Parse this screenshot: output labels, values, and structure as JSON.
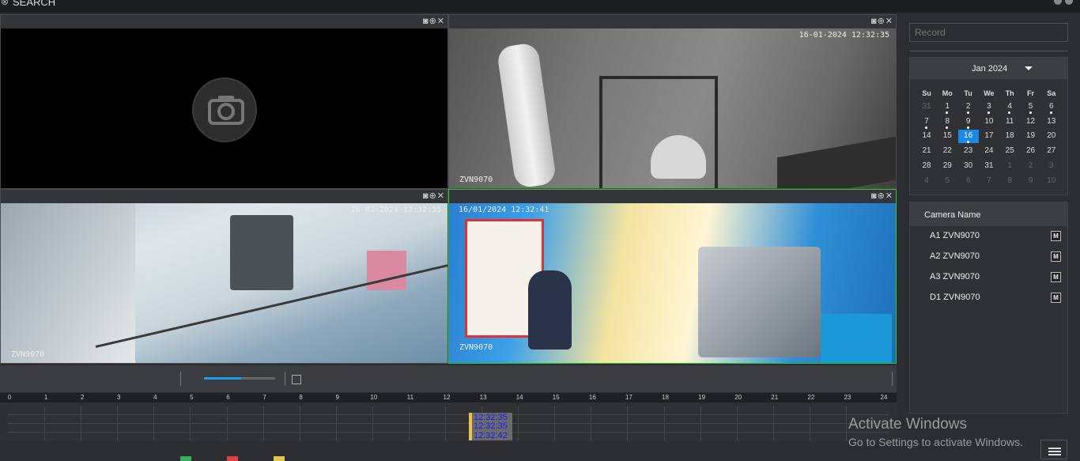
{
  "app": {
    "title": "SEARCH"
  },
  "tiles": [
    {
      "name": "tile-1",
      "timestamp": "",
      "camera_label": "",
      "empty": true
    },
    {
      "name": "tile-2",
      "timestamp": "16-01-2024 12:32:35",
      "camera_label": "ZVN9070"
    },
    {
      "name": "tile-3",
      "timestamp": "16-01-2024 12:32:35",
      "camera_label": "ZVN9070"
    },
    {
      "name": "tile-4",
      "timestamp": "16/01/2024 12:32:41",
      "camera_label": "ZVN9070",
      "active": true
    }
  ],
  "tile_tools": {
    "snapshot": "◙",
    "zoom": "⊕",
    "close": "✕"
  },
  "playback": {
    "speed_fraction": 0.52
  },
  "timeline": {
    "hours": [
      "0",
      "1",
      "2",
      "3",
      "4",
      "5",
      "6",
      "7",
      "8",
      "9",
      "10",
      "11",
      "12",
      "13",
      "14",
      "15",
      "16",
      "17",
      "18",
      "19",
      "20",
      "21",
      "22",
      "23",
      "24"
    ],
    "markers": [
      "12:32:35",
      "12:32:35",
      "12:32:42"
    ]
  },
  "legend": {
    "colors": [
      "#2fb35a",
      "#e04040",
      "#e8c545"
    ]
  },
  "sidebar": {
    "search_placeholder": "Record",
    "calendar": {
      "month": "Jan 2024",
      "dow": [
        "Su",
        "Mo",
        "Tu",
        "We",
        "Th",
        "Fr",
        "Sa"
      ],
      "weeks": [
        [
          "31",
          "1",
          "2",
          "3",
          "4",
          "5",
          "6"
        ],
        [
          "7",
          "8",
          "9",
          "10",
          "11",
          "12",
          "13"
        ],
        [
          "14",
          "15",
          "16",
          "17",
          "18",
          "19",
          "20"
        ],
        [
          "21",
          "22",
          "23",
          "24",
          "25",
          "26",
          "27"
        ],
        [
          "28",
          "29",
          "30",
          "31",
          "1",
          "2",
          "3"
        ],
        [
          "4",
          "5",
          "6",
          "7",
          "8",
          "9",
          "10"
        ]
      ],
      "selected": "16"
    },
    "cameras": {
      "title": "Camera Name",
      "items": [
        {
          "name": "A1 ZVN9070",
          "btn": "M"
        },
        {
          "name": "A2 ZVN9070",
          "btn": "M"
        },
        {
          "name": "A3 ZVN9070",
          "btn": "M"
        },
        {
          "name": "D1 ZVN9070",
          "btn": "M"
        }
      ]
    }
  },
  "watermark": {
    "line1": "Activate Windows",
    "line2": "Go to Settings to activate Windows."
  },
  "colors": {
    "accent": "#1e88e5",
    "active_border": "#28c828",
    "marker_text": "#1a1aff"
  }
}
